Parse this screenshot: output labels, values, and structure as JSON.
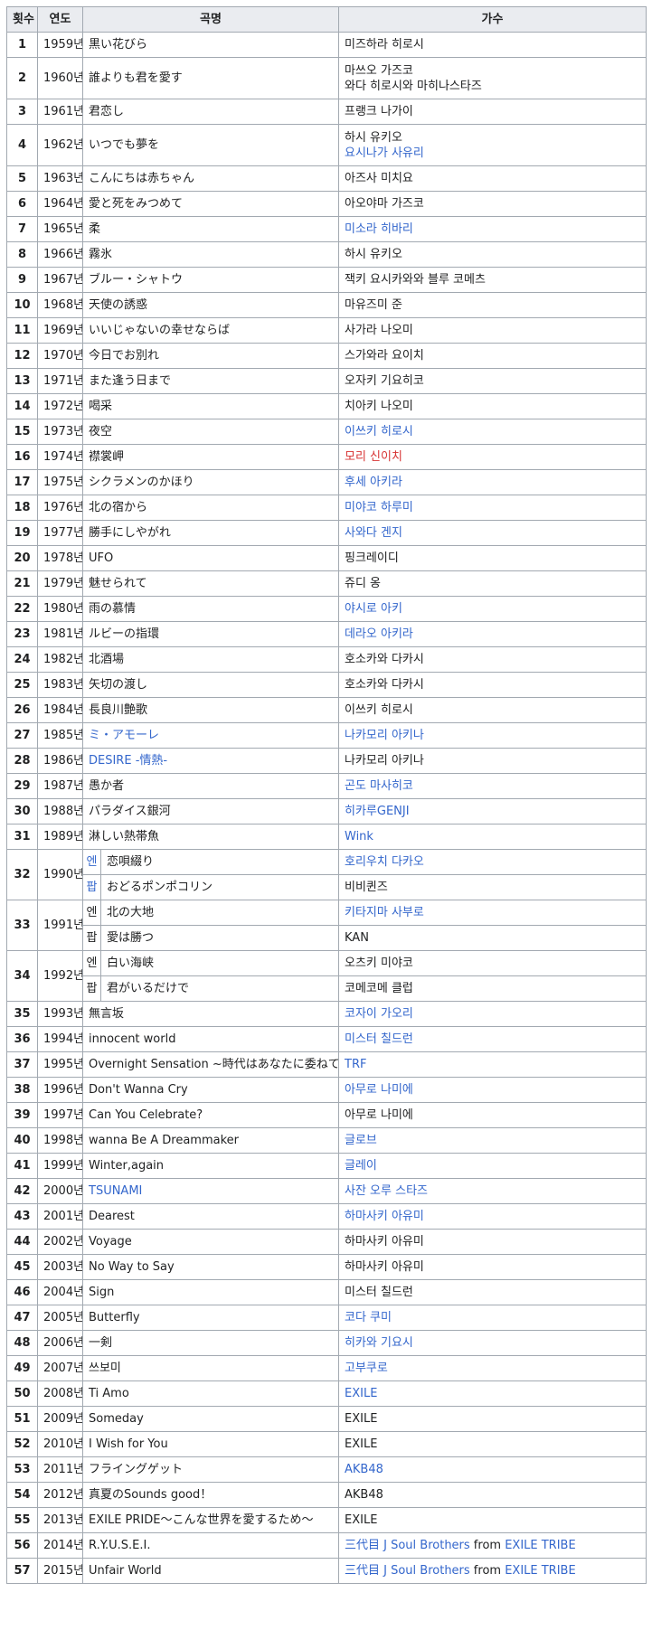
{
  "columns": [
    {
      "label": "횟수"
    },
    {
      "label": "연도"
    },
    {
      "label": "곡명"
    },
    {
      "label": "가수"
    }
  ],
  "rows": [
    {
      "num": "1",
      "year": "1959년",
      "song": "黒い花びら",
      "singer": [
        {
          "text": "미즈하라 히로시",
          "link": false
        }
      ]
    },
    {
      "num": "2",
      "year": "1960년",
      "song": "誰よりも君を愛す",
      "singer": [
        {
          "text": "마쓰오 가즈코",
          "link": false
        },
        {
          "text": "와다 히로시와 마히나스타즈",
          "link": false
        }
      ]
    },
    {
      "num": "3",
      "year": "1961년",
      "song": "君恋し",
      "singer": [
        {
          "text": "프랭크 나가이",
          "link": false
        }
      ]
    },
    {
      "num": "4",
      "year": "1962년",
      "song": "いつでも夢を",
      "singer": [
        {
          "text": "하시 유키오",
          "link": false
        },
        {
          "text": "요시나가 사유리",
          "link": true
        }
      ]
    },
    {
      "num": "5",
      "year": "1963년",
      "song": "こんにちは赤ちゃん",
      "singer": [
        {
          "text": "아즈사 미치요",
          "link": false
        }
      ]
    },
    {
      "num": "6",
      "year": "1964년",
      "song": "愛と死をみつめて",
      "singer": [
        {
          "text": "아오야마 가즈코",
          "link": false
        }
      ]
    },
    {
      "num": "7",
      "year": "1965년",
      "song": "柔",
      "singer": [
        {
          "text": "미소라 히바리",
          "link": true
        }
      ]
    },
    {
      "num": "8",
      "year": "1966년",
      "song": "霧氷",
      "singer": [
        {
          "text": "하시 유키오",
          "link": false
        }
      ]
    },
    {
      "num": "9",
      "year": "1967년",
      "song": "ブルー・シャトウ",
      "singer": [
        {
          "text": "잭키 요시카와와 블루 코메츠",
          "link": false
        }
      ]
    },
    {
      "num": "10",
      "year": "1968년",
      "song": "天使の誘惑",
      "singer": [
        {
          "text": "마유즈미 준",
          "link": false
        }
      ]
    },
    {
      "num": "11",
      "year": "1969년",
      "song": "いいじゃないの幸せならば",
      "singer": [
        {
          "text": "사가라 나오미",
          "link": false
        }
      ]
    },
    {
      "num": "12",
      "year": "1970년",
      "song": "今日でお別れ",
      "singer": [
        {
          "text": "스가와라 요이치",
          "link": false
        }
      ]
    },
    {
      "num": "13",
      "year": "1971년",
      "song": "また逢う日まで",
      "singer": [
        {
          "text": "오자키 기요히코",
          "link": false
        }
      ]
    },
    {
      "num": "14",
      "year": "1972년",
      "song": "喝采",
      "singer": [
        {
          "text": "치아키 나오미",
          "link": false
        }
      ]
    },
    {
      "num": "15",
      "year": "1973년",
      "song": "夜空",
      "singer": [
        {
          "text": "이쓰키 히로시",
          "link": true
        }
      ]
    },
    {
      "num": "16",
      "year": "1974년",
      "song": "襟裳岬",
      "singer": [
        {
          "text": "모리 신이치",
          "link": "red"
        }
      ]
    },
    {
      "num": "17",
      "year": "1975년",
      "song": "シクラメンのかほり",
      "singer": [
        {
          "text": "후세 아키라",
          "link": true
        }
      ]
    },
    {
      "num": "18",
      "year": "1976년",
      "song": "北の宿から",
      "singer": [
        {
          "text": "미야코 하루미",
          "link": true
        }
      ]
    },
    {
      "num": "19",
      "year": "1977년",
      "song": "勝手にしやがれ",
      "singer": [
        {
          "text": "사와다 겐지",
          "link": true
        }
      ]
    },
    {
      "num": "20",
      "year": "1978년",
      "song": "UFO",
      "singer": [
        {
          "text": "핑크레이디",
          "link": false
        }
      ]
    },
    {
      "num": "21",
      "year": "1979년",
      "song": "魅せられて",
      "singer": [
        {
          "text": "쥬디 옹",
          "link": false
        }
      ]
    },
    {
      "num": "22",
      "year": "1980년",
      "song": "雨の慕情",
      "singer": [
        {
          "text": "야시로 아키",
          "link": true
        }
      ]
    },
    {
      "num": "23",
      "year": "1981년",
      "song": "ルビーの指環",
      "singer": [
        {
          "text": "데라오 아키라",
          "link": true
        }
      ]
    },
    {
      "num": "24",
      "year": "1982년",
      "song": "北酒場",
      "singer": [
        {
          "text": "호소카와 다카시",
          "link": false
        }
      ]
    },
    {
      "num": "25",
      "year": "1983년",
      "song": "矢切の渡し",
      "singer": [
        {
          "text": "호소카와 다카시",
          "link": false
        }
      ]
    },
    {
      "num": "26",
      "year": "1984년",
      "song": "長良川艶歌",
      "singer": [
        {
          "text": "이쓰키 히로시",
          "link": false
        }
      ]
    },
    {
      "num": "27",
      "year": "1985년",
      "song": "ミ・アモーレ",
      "song_link": true,
      "singer": [
        {
          "text": "나카모리 아키나",
          "link": true
        }
      ]
    },
    {
      "num": "28",
      "year": "1986년",
      "song": "DESIRE -情熱-",
      "song_link": true,
      "singer": [
        {
          "text": "나카모리 아키나",
          "link": false
        }
      ]
    },
    {
      "num": "29",
      "year": "1987년",
      "song": "愚か者",
      "singer": [
        {
          "text": "곤도 마사히코",
          "link": true
        }
      ]
    },
    {
      "num": "30",
      "year": "1988년",
      "song": "パラダイス銀河",
      "singer": [
        {
          "text": "히카루GENJI",
          "link": true
        }
      ]
    },
    {
      "num": "31",
      "year": "1989년",
      "song": "淋しい熱帯魚",
      "singer": [
        {
          "text": "Wink",
          "link": true
        }
      ]
    },
    {
      "num": "32",
      "year": "1990년",
      "split": [
        {
          "genre": "엔",
          "genre_link": true,
          "song": "恋唄綴り",
          "singer": [
            {
              "text": "호리우치 다카오",
              "link": true
            }
          ]
        },
        {
          "genre": "팝",
          "genre_link": true,
          "song": "おどるポンポコリン",
          "singer": [
            {
              "text": "비비퀸즈",
              "link": false
            }
          ]
        }
      ]
    },
    {
      "num": "33",
      "year": "1991년",
      "split": [
        {
          "genre": "엔",
          "genre_link": false,
          "song": "北の大地",
          "singer": [
            {
              "text": "키타지마 사부로",
              "link": true
            }
          ]
        },
        {
          "genre": "팝",
          "genre_link": false,
          "song": "愛は勝つ",
          "singer": [
            {
              "text": "KAN",
              "link": false
            }
          ]
        }
      ]
    },
    {
      "num": "34",
      "year": "1992년",
      "split": [
        {
          "genre": "엔",
          "genre_link": false,
          "song": "白い海峡",
          "singer": [
            {
              "text": "오츠키 미야코",
              "link": false
            }
          ]
        },
        {
          "genre": "팝",
          "genre_link": false,
          "song": "君がいるだけで",
          "singer": [
            {
              "text": "코메코메 클럽",
              "link": false
            }
          ]
        }
      ]
    },
    {
      "num": "35",
      "year": "1993년",
      "song": "無言坂",
      "singer": [
        {
          "text": "코자이 가오리",
          "link": true
        }
      ]
    },
    {
      "num": "36",
      "year": "1994년",
      "song": "innocent world",
      "singer": [
        {
          "text": "미스터 칠드런",
          "link": true
        }
      ]
    },
    {
      "num": "37",
      "year": "1995년",
      "song": "Overnight Sensation ~時代はあなたに委ねてる~",
      "singer": [
        {
          "text": "TRF",
          "link": true
        }
      ]
    },
    {
      "num": "38",
      "year": "1996년",
      "song": "Don't Wanna Cry",
      "singer": [
        {
          "text": "아무로 나미에",
          "link": true
        }
      ]
    },
    {
      "num": "39",
      "year": "1997년",
      "song": "Can You Celebrate?",
      "singer": [
        {
          "text": "아무로 나미에",
          "link": false
        }
      ]
    },
    {
      "num": "40",
      "year": "1998년",
      "song": "wanna Be A Dreammaker",
      "singer": [
        {
          "text": "글로브",
          "link": true
        }
      ]
    },
    {
      "num": "41",
      "year": "1999년",
      "song": "Winter,again",
      "singer": [
        {
          "text": "글레이",
          "link": true
        }
      ]
    },
    {
      "num": "42",
      "year": "2000년",
      "song": "TSUNAMI",
      "song_link": true,
      "singer": [
        {
          "text": "사잔 오루 스타즈",
          "link": true
        }
      ]
    },
    {
      "num": "43",
      "year": "2001년",
      "song": "Dearest",
      "singer": [
        {
          "text": "하마사키 아유미",
          "link": true
        }
      ]
    },
    {
      "num": "44",
      "year": "2002년",
      "song": "Voyage",
      "singer": [
        {
          "text": "하마사키 아유미",
          "link": false
        }
      ]
    },
    {
      "num": "45",
      "year": "2003년",
      "song": "No Way to Say",
      "singer": [
        {
          "text": "하마사키 아유미",
          "link": false
        }
      ]
    },
    {
      "num": "46",
      "year": "2004년",
      "song": "Sign",
      "singer": [
        {
          "text": "미스터 칠드런",
          "link": false
        }
      ]
    },
    {
      "num": "47",
      "year": "2005년",
      "song": "Butterfly",
      "singer": [
        {
          "text": "코다 쿠미",
          "link": true
        }
      ]
    },
    {
      "num": "48",
      "year": "2006년",
      "song": "一剣",
      "singer": [
        {
          "text": "히카와 기요시",
          "link": true
        }
      ]
    },
    {
      "num": "49",
      "year": "2007년",
      "song": "쓰보미",
      "singer": [
        {
          "text": "고부쿠로",
          "link": true
        }
      ]
    },
    {
      "num": "50",
      "year": "2008년",
      "song": "Ti Amo",
      "singer": [
        {
          "text": "EXILE",
          "link": true
        }
      ]
    },
    {
      "num": "51",
      "year": "2009년",
      "song": "Someday",
      "singer": [
        {
          "text": "EXILE",
          "link": false
        }
      ]
    },
    {
      "num": "52",
      "year": "2010년",
      "song": "I Wish for You",
      "singer": [
        {
          "text": "EXILE",
          "link": false
        }
      ]
    },
    {
      "num": "53",
      "year": "2011년",
      "song": "フライングゲット",
      "singer": [
        {
          "text": "AKB48",
          "link": true
        }
      ]
    },
    {
      "num": "54",
      "year": "2012년",
      "song": "真夏のSounds good！",
      "singer": [
        {
          "text": "AKB48",
          "link": false
        }
      ]
    },
    {
      "num": "55",
      "year": "2013년",
      "song": "EXILE PRIDE～こんな世界を愛するため～",
      "singer": [
        {
          "text": "EXILE",
          "link": false
        }
      ]
    },
    {
      "num": "56",
      "year": "2014년",
      "song": "R.Y.U.S.E.I.",
      "singer_inline": [
        {
          "text": "三代目 J Soul Brothers",
          "link": true
        },
        {
          "text": " from ",
          "link": false
        },
        {
          "text": "EXILE TRIBE",
          "link": true
        }
      ]
    },
    {
      "num": "57",
      "year": "2015년",
      "song": "Unfair World",
      "singer_inline": [
        {
          "text": "三代目 J Soul Brothers",
          "link": true
        },
        {
          "text": " from ",
          "link": false
        },
        {
          "text": "EXILE TRIBE",
          "link": true
        }
      ]
    }
  ],
  "colors": {
    "link": "#3366cc",
    "redlink": "#d73333",
    "text": "#202122",
    "header_bg": "#eaecf0",
    "border": "#a2a9b1"
  }
}
